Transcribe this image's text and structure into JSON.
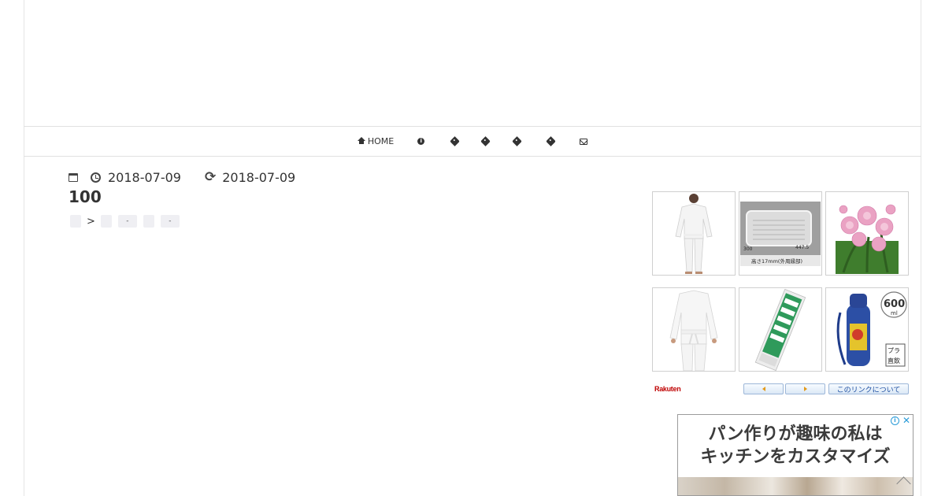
{
  "nav": {
    "home_label": "HOME",
    "items": [
      {
        "icon": "home-icon",
        "label": "HOME"
      },
      {
        "icon": "info-icon",
        "label": ""
      },
      {
        "icon": "tag-icon",
        "label": ""
      },
      {
        "icon": "tag-icon",
        "label": ""
      },
      {
        "icon": "tag-icon",
        "label": ""
      },
      {
        "icon": "tag-icon",
        "label": ""
      },
      {
        "icon": "envelope-icon",
        "label": ""
      }
    ]
  },
  "post": {
    "published": "2018-07-09",
    "updated": "2018-07-09",
    "title": "100"
  },
  "breadcrumb": {
    "separator": ">",
    "items": [
      "",
      "",
      "-",
      "",
      "-"
    ]
  },
  "rakuten": {
    "logo": "Rakuten",
    "about_label": "このリンクについて",
    "items": [
      {
        "icon": "karate-uniform-icon"
      },
      {
        "icon": "aluminum-tray-icon",
        "dim_a": "300",
        "dim_b": "447.5",
        "caption": "高さ17mm(外周縁部)"
      },
      {
        "icon": "pink-chrysanthemum-icon"
      },
      {
        "icon": "karate-uniform-icon"
      },
      {
        "icon": "disaster-kit-bag-icon"
      },
      {
        "icon": "water-bottle-icon",
        "badge": "600",
        "badge_unit": "ml",
        "label_a": "プラ",
        "label_b": "直飲"
      }
    ]
  },
  "ad": {
    "line1": "パン作りが趣味の私は",
    "line2": "キッチンをカスタマイズ",
    "info_glyph": "i",
    "close_glyph": "✕"
  },
  "colors": {
    "border": "#e1e1e1",
    "text": "#333333",
    "rakuten_red": "#bf0000",
    "ad_blue": "#2a9bd8"
  }
}
